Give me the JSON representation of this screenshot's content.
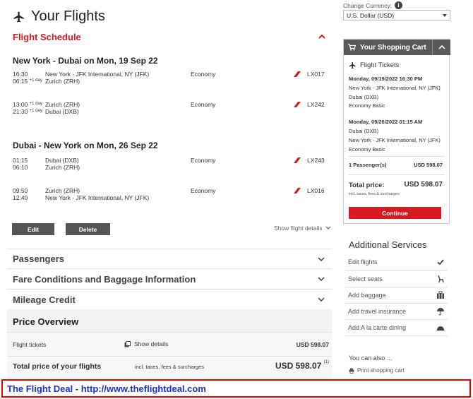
{
  "header": {
    "title": "Your Flights",
    "section": "Flight Schedule"
  },
  "outbound": {
    "heading": "New York - Dubai on Mon, 19 Sep 22",
    "segments": [
      {
        "dep": "16:30",
        "arr": "06:15",
        "arr_note": "+1 day",
        "from": "New York - JFK International, NY (JFK)",
        "to": "Zurich (ZRH)",
        "cabin": "Economy",
        "flight": "LX017"
      },
      {
        "dep": "13:00",
        "dep_note": "+1 day",
        "arr": "21:30",
        "arr_note": "+1 day",
        "from": "Zurich (ZRH)",
        "to": "Dubai (DXB)",
        "cabin": "Economy",
        "flight": "LX242"
      }
    ]
  },
  "inbound": {
    "heading": "Dubai - New York on Mon, 26 Sep 22",
    "segments": [
      {
        "dep": "01:15",
        "arr": "06:10",
        "from": "Dubai (DXB)",
        "to": "Zurich (ZRH)",
        "cabin": "Economy",
        "flight": "LX243"
      },
      {
        "dep": "09:50",
        "arr": "12:40",
        "from": "Zurich (ZRH)",
        "to": "New York - JFK International, NY (JFK)",
        "cabin": "Economy",
        "flight": "LX016"
      }
    ]
  },
  "actions": {
    "edit": "Edit",
    "delete": "Delete",
    "show_flight_details": "Show flight details"
  },
  "accordions": {
    "passengers": "Passengers",
    "fare": "Fare Conditions and Baggage Information",
    "mileage": "Mileage Credit"
  },
  "price_overview": {
    "title": "Price Overview",
    "flight_tickets_label": "Flight tickets",
    "show_details": "Show details",
    "flight_tickets_amount": "USD 598.07",
    "total_label": "Total price of your flights",
    "total_note": "incl. taxes, fees & surcharges",
    "total_amount": "USD 598.07",
    "total_footnote": "(1)"
  },
  "currency": {
    "label": "Change Currency:",
    "selected": "U.S. Dollar (USD)"
  },
  "cart": {
    "title": "Your Shopping Cart",
    "section": "Flight Tickets",
    "outbound_date": "Monday, 09/19/2022 16:30 PM",
    "outbound_from": "New York - JFK International, NY (JFK)",
    "outbound_to": "Dubai (DXB)",
    "outbound_fare": "Economy Basic",
    "inbound_date": "Monday, 09/26/2022 01:15 AM",
    "inbound_from": "Dubai (DXB)",
    "inbound_to": "New York - JFK International, NY (JFK)",
    "inbound_fare": "Economy Basic",
    "passengers_label": "1 Passenger(s)",
    "passengers_amount": "USD 598.07",
    "total_label": "Total price:",
    "total_amount": "USD 598.07",
    "total_note": "incl. taxes, fees & surcharges",
    "continue": "Continue"
  },
  "services": {
    "title": "Additional Services",
    "items": [
      "Edit flights",
      "Select seats",
      "Add baggage",
      "Add travel insurance",
      "Add A la carte dining"
    ]
  },
  "also": {
    "title": "You can also ...",
    "print": "Print shopping cart"
  },
  "banner": "The Flight Deal - http://www.theflightdeal.com",
  "colors": {
    "accent": "#d71920",
    "banner_text": "#1a33cc",
    "dark_button": "#555555"
  }
}
